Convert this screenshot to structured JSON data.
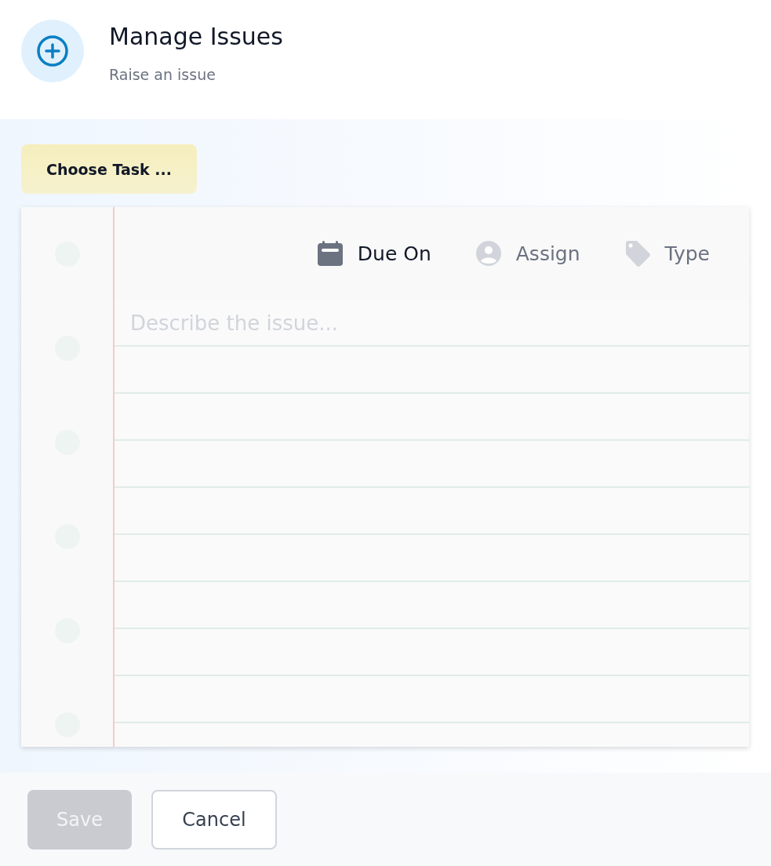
{
  "header": {
    "title": "Manage Issues",
    "subtitle": "Raise an issue"
  },
  "task_button": {
    "label": "Choose Task ..."
  },
  "toolbar": [
    {
      "kind": "due",
      "label": "Due On",
      "active": true
    },
    {
      "kind": "assign",
      "label": "Assign",
      "active": false
    },
    {
      "kind": "type",
      "label": "Type",
      "active": false
    }
  ],
  "description": {
    "placeholder": "Describe the issue..."
  },
  "buttons": [
    {
      "kind": "primary",
      "label": "Save",
      "disabled": true
    },
    {
      "kind": "secondary",
      "label": "Cancel",
      "disabled": false
    }
  ]
}
